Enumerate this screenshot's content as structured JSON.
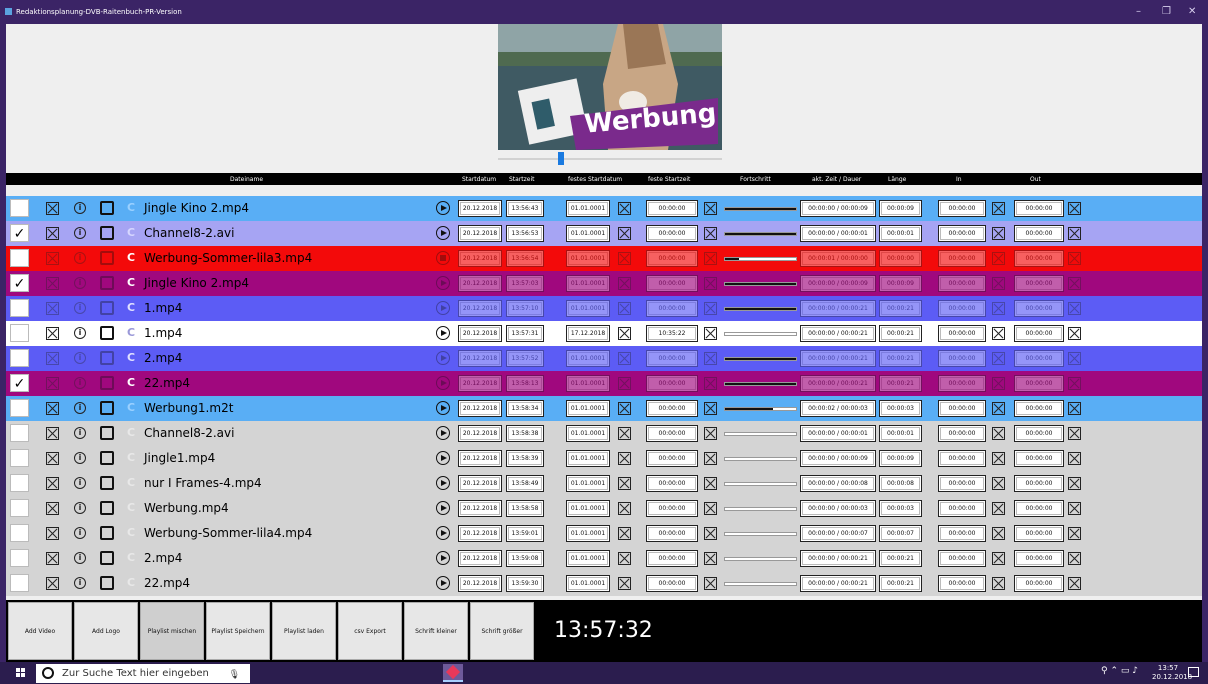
{
  "window": {
    "title": "Redaktionsplanung-DVB-Raitenbuch-PR-Version",
    "controls": [
      "–",
      "❐",
      "✕"
    ]
  },
  "preview": {
    "overlay_text": "Werbung"
  },
  "columns": {
    "filename": "Dateiname",
    "startdate": "Startdatum",
    "starttime": "Startzeit",
    "fixed_date": "festes Startdatum",
    "fixed_time": "feste Startzeit",
    "progress": "Fortschritt",
    "current": "akt. Zeit / Dauer",
    "length": "Länge",
    "in": "In",
    "out": "Out"
  },
  "rows": [
    {
      "checked": false,
      "c": "C",
      "name": "Jingle Kino 2.mp4",
      "date": "20.12.2018",
      "time": "13:56:43",
      "fdate": "01.01.0001",
      "ftime": "00:00:00",
      "progress": 1.0,
      "cur": "00:00:00 / 00:00:09",
      "len": "00:00:09",
      "in": "00:00:00",
      "out": "00:00:00",
      "bg": "#59aef5",
      "ccolor": "#9ad0ff",
      "dim": false,
      "stop": false
    },
    {
      "checked": true,
      "c": "C",
      "name": "Channel8-2.avi",
      "date": "20.12.2018",
      "time": "13:56:53",
      "fdate": "01.01.0001",
      "ftime": "00:00:00",
      "progress": 1.0,
      "cur": "00:00:00 / 00:00:01",
      "len": "00:00:01",
      "in": "00:00:00",
      "out": "00:00:00",
      "bg": "#a6a4f3",
      "ccolor": "#d6d6ff",
      "dim": false,
      "stop": false
    },
    {
      "checked": false,
      "c": "C",
      "name": "Werbung-Sommer-lila3.mp4",
      "date": "20.12.2018",
      "time": "13:56:54",
      "fdate": "01.01.0001",
      "ftime": "00:00:00",
      "progress": 0.2,
      "cur": "00:00:01 / 00:00:00",
      "len": "00:00:00",
      "in": "00:00:00",
      "out": "00:00:00",
      "bg": "#f30a0a",
      "ccolor": "#ffffff",
      "dim": true,
      "stop": true
    },
    {
      "checked": true,
      "c": "C",
      "name": "Jingle Kino 2.mp4",
      "date": "20.12.2018",
      "time": "13:57:03",
      "fdate": "01.01.0001",
      "ftime": "00:00:00",
      "progress": 1.0,
      "cur": "00:00:00 / 00:00:09",
      "len": "00:00:09",
      "in": "00:00:00",
      "out": "00:00:00",
      "bg": "#a0087e",
      "ccolor": "#ffffff",
      "dim": true,
      "stop": false
    },
    {
      "checked": false,
      "c": "C",
      "name": "1.mp4",
      "date": "20.12.2018",
      "time": "13:57:10",
      "fdate": "01.01.0001",
      "ftime": "00:00:00",
      "progress": 1.0,
      "cur": "00:00:00 / 00:00:21",
      "len": "00:00:21",
      "in": "00:00:00",
      "out": "00:00:00",
      "bg": "#5c5cf5",
      "ccolor": "#e0e0ff",
      "dim": true,
      "stop": false
    },
    {
      "checked": false,
      "c": "C",
      "name": "1.mp4",
      "date": "20.12.2018",
      "time": "13:57:31",
      "fdate": "17.12.2018",
      "ftime": "10:35:22",
      "progress": 0.0,
      "cur": "00:00:00 / 00:00:21",
      "len": "00:00:21",
      "in": "00:00:00",
      "out": "00:00:00",
      "bg": "#ffffff",
      "ccolor": "#9a98d8",
      "dim": false,
      "stop": false
    },
    {
      "checked": false,
      "c": "C",
      "name": "2.mp4",
      "date": "20.12.2018",
      "time": "13:57:52",
      "fdate": "01.01.0001",
      "ftime": "00:00:00",
      "progress": 1.0,
      "cur": "00:00:00 / 00:00:21",
      "len": "00:00:21",
      "in": "00:00:00",
      "out": "00:00:00",
      "bg": "#5c5cf5",
      "ccolor": "#e0e0ff",
      "dim": true,
      "stop": false
    },
    {
      "checked": true,
      "c": "C",
      "name": "22.mp4",
      "date": "20.12.2018",
      "time": "13:58:13",
      "fdate": "01.01.0001",
      "ftime": "00:00:00",
      "progress": 1.0,
      "cur": "00:00:00 / 00:00:21",
      "len": "00:00:21",
      "in": "00:00:00",
      "out": "00:00:00",
      "bg": "#a0087e",
      "ccolor": "#ffffff",
      "dim": true,
      "stop": false
    },
    {
      "checked": false,
      "c": "C",
      "name": "Werbung1.m2t",
      "date": "20.12.2018",
      "time": "13:58:34",
      "fdate": "01.01.0001",
      "ftime": "00:00:00",
      "progress": 0.67,
      "cur": "00:00:02 / 00:00:03",
      "len": "00:00:03",
      "in": "00:00:00",
      "out": "00:00:00",
      "bg": "#59aef5",
      "ccolor": "#9ad0ff",
      "dim": false,
      "stop": false
    },
    {
      "checked": false,
      "c": "C",
      "name": "Channel8-2.avi",
      "date": "20.12.2018",
      "time": "13:58:38",
      "fdate": "01.01.0001",
      "ftime": "00:00:00",
      "progress": 0.0,
      "cur": "00:00:00 / 00:00:01",
      "len": "00:00:01",
      "in": "00:00:00",
      "out": "00:00:00",
      "bg": "#d4d4d4",
      "ccolor": "#e8e8e8",
      "dim": false,
      "stop": false
    },
    {
      "checked": false,
      "c": "C",
      "name": "Jingle1.mp4",
      "date": "20.12.2018",
      "time": "13:58:39",
      "fdate": "01.01.0001",
      "ftime": "00:00:00",
      "progress": 0.0,
      "cur": "00:00:00 / 00:00:09",
      "len": "00:00:09",
      "in": "00:00:00",
      "out": "00:00:00",
      "bg": "#d4d4d4",
      "ccolor": "#e8e8e8",
      "dim": false,
      "stop": false
    },
    {
      "checked": false,
      "c": "C",
      "name": "nur I Frames-4.mp4",
      "date": "20.12.2018",
      "time": "13:58:49",
      "fdate": "01.01.0001",
      "ftime": "00:00:00",
      "progress": 0.0,
      "cur": "00:00:00 / 00:00:08",
      "len": "00:00:08",
      "in": "00:00:00",
      "out": "00:00:00",
      "bg": "#d4d4d4",
      "ccolor": "#e8e8e8",
      "dim": false,
      "stop": false
    },
    {
      "checked": false,
      "c": "C",
      "name": "Werbung.mp4",
      "date": "20.12.2018",
      "time": "13:58:58",
      "fdate": "01.01.0001",
      "ftime": "00:00:00",
      "progress": 0.0,
      "cur": "00:00:00 / 00:00:03",
      "len": "00:00:03",
      "in": "00:00:00",
      "out": "00:00:00",
      "bg": "#d4d4d4",
      "ccolor": "#e8e8e8",
      "dim": false,
      "stop": false
    },
    {
      "checked": false,
      "c": "C",
      "name": "Werbung-Sommer-lila4.mp4",
      "date": "20.12.2018",
      "time": "13:59:01",
      "fdate": "01.01.0001",
      "ftime": "00:00:00",
      "progress": 0.0,
      "cur": "00:00:00 / 00:00:07",
      "len": "00:00:07",
      "in": "00:00:00",
      "out": "00:00:00",
      "bg": "#d4d4d4",
      "ccolor": "#e8e8e8",
      "dim": false,
      "stop": false
    },
    {
      "checked": false,
      "c": "C",
      "name": "2.mp4",
      "date": "20.12.2018",
      "time": "13:59:08",
      "fdate": "01.01.0001",
      "ftime": "00:00:00",
      "progress": 0.0,
      "cur": "00:00:00 / 00:00:21",
      "len": "00:00:21",
      "in": "00:00:00",
      "out": "00:00:00",
      "bg": "#d4d4d4",
      "ccolor": "#e8e8e8",
      "dim": false,
      "stop": false
    },
    {
      "checked": false,
      "c": "C",
      "name": "22.mp4",
      "date": "20.12.2018",
      "time": "13:59:30",
      "fdate": "01.01.0001",
      "ftime": "00:00:00",
      "progress": 0.0,
      "cur": "00:00:00 / 00:00:21",
      "len": "00:00:21",
      "in": "00:00:00",
      "out": "00:00:00",
      "bg": "#d4d4d4",
      "ccolor": "#e8e8e8",
      "dim": false,
      "stop": false
    }
  ],
  "toolbar": {
    "buttons": [
      "Add Video",
      "Add Logo",
      "Playlist mischen",
      "Playlist Speichern",
      "Playlist laden",
      "csv Export",
      "Schrift kleiner",
      "Schrift größer"
    ],
    "clock": "13:57:32"
  },
  "taskbar": {
    "search_placeholder": "Zur Suche Text hier eingeben",
    "time": "13:57",
    "date": "20.12.2018"
  }
}
